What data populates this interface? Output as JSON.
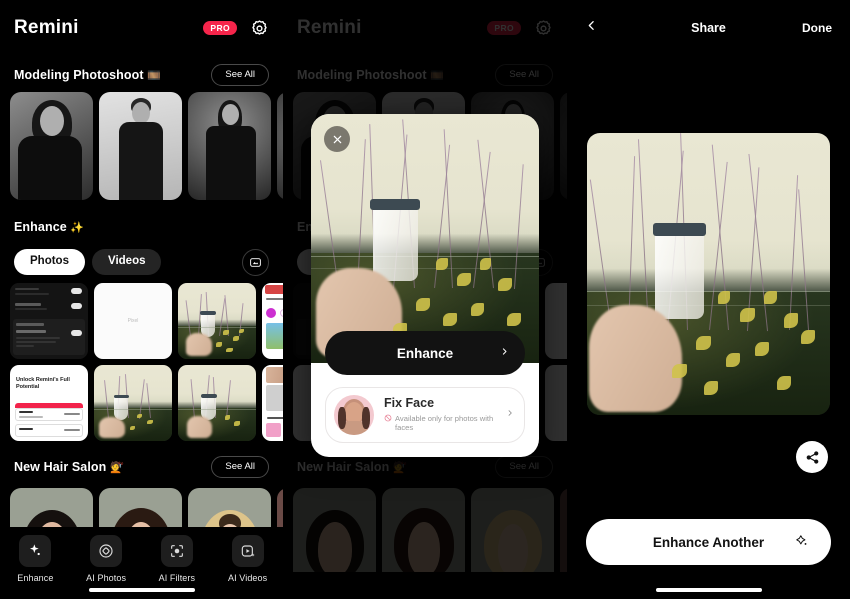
{
  "app": {
    "name": "Remini",
    "pro_badge": "PRO",
    "gear_icon": "gear-icon"
  },
  "panels": {
    "home": {
      "sections": [
        {
          "id": "modeling-photoshoot",
          "title": "Modeling Photoshoot",
          "emoji": "🎞️",
          "see_all": "See All",
          "cards": 4
        },
        {
          "id": "enhance",
          "title": "Enhance",
          "emoji": "✨",
          "tabs": [
            {
              "label": "Photos",
              "selected": true
            },
            {
              "label": "Videos",
              "selected": false
            }
          ],
          "picker_icon": "photo-picker-icon"
        },
        {
          "id": "new-hair-salon",
          "title": "New Hair Salon",
          "emoji": "💇",
          "see_all": "See All",
          "cards": 4
        }
      ],
      "gallery": {
        "row1": [
          "settings-screenshot",
          "blank-white-note",
          "cup-flowers-photo",
          "app-collage-screenshot"
        ],
        "row2": [
          "paywall-screenshot",
          "cup-flowers-photo",
          "cup-flowers-photo",
          "fashion-collage-screenshot"
        ]
      }
    },
    "modal": {
      "close_icon": "close-icon",
      "photo": "cup-flowers-photo",
      "enhance_label": "Enhance",
      "enhance_chevron": "chevron-right-icon",
      "fix_face": {
        "title": "Fix Face",
        "subtitle": "Available only for photos with faces",
        "unavailable_icon": "no-entry-icon",
        "chevron": "chevron-right-icon",
        "avatar": "woman-portrait-avatar"
      }
    },
    "share": {
      "back_icon": "chevron-left-icon",
      "title": "Share",
      "done_label": "Done",
      "result_photo": "cup-flowers-photo-enhanced",
      "share_fab_icon": "share-icon",
      "primary_button": "Enhance Another",
      "primary_button_icon": "sparkle-icon"
    }
  },
  "bottom_nav": {
    "items": [
      {
        "label": "Enhance",
        "icon": "sparkle-icon",
        "active": true
      },
      {
        "label": "AI Photos",
        "icon": "ai-photos-icon",
        "active": false
      },
      {
        "label": "AI Filters",
        "icon": "ai-filters-icon",
        "active": false
      },
      {
        "label": "AI Videos",
        "icon": "ai-videos-icon",
        "active": false
      }
    ]
  },
  "colors": {
    "background": "#000000",
    "accent_pro": "#f6254b",
    "surface_light": "#ffffff",
    "chip_inactive": "#242424"
  }
}
